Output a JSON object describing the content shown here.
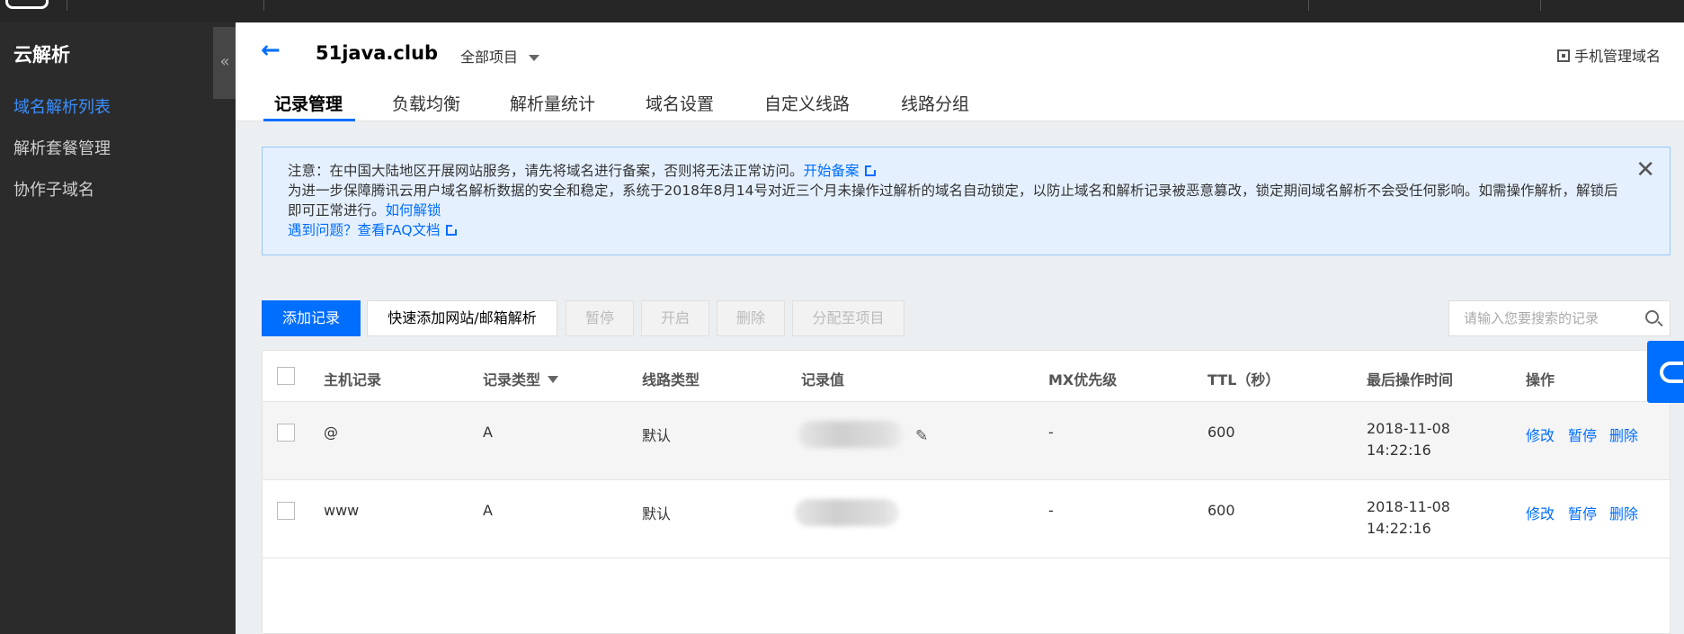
{
  "sidebar": {
    "title": "云解析",
    "collapse_label": "«",
    "items": [
      {
        "label": "域名解析列表",
        "active": true
      },
      {
        "label": "解析套餐管理",
        "active": false
      },
      {
        "label": "协作子域名",
        "active": false
      }
    ]
  },
  "header": {
    "back_icon": "←",
    "domain": "51java.club",
    "project_select": "全部项目",
    "mobile_manage": "手机管理域名"
  },
  "tabs": [
    "记录管理",
    "负载均衡",
    "解析量统计",
    "域名设置",
    "自定义线路",
    "线路分组"
  ],
  "notice": {
    "line1_text": "注意：在中国大陆地区开展网站服务，请先将域名进行备案，否则将无法正常访问。",
    "line1_link": "开始备案",
    "line2_text": "为进一步保障腾讯云用户域名解析数据的安全和稳定，系统于2018年8月14号对近三个月未操作过解析的域名自动锁定，以防止域名和解析记录被恶意篡改，锁定期间域名解析不会受任何影响。如需操作解析，解锁后即可正常进行。",
    "line2_link": "如何解锁",
    "line3_link": "遇到问题？查看FAQ文档",
    "close_icon": "✕"
  },
  "toolbar": {
    "add": "添加记录",
    "quick_add": "快速添加网站/邮箱解析",
    "pause": "暂停",
    "start": "开启",
    "delete": "删除",
    "assign": "分配至项目",
    "search_placeholder": "请输入您要搜索的记录"
  },
  "table": {
    "columns": [
      "主机记录",
      "记录类型",
      "线路类型",
      "记录值",
      "MX优先级",
      "TTL（秒）",
      "最后操作时间",
      "操作"
    ],
    "rows": [
      {
        "host": "@",
        "type": "A",
        "line": "默认",
        "mx": "-",
        "ttl": "600",
        "date": "2018-11-08",
        "time": "14:22:16",
        "actions": [
          "修改",
          "暂停",
          "删除"
        ]
      },
      {
        "host": "www",
        "type": "A",
        "line": "默认",
        "mx": "-",
        "ttl": "600",
        "date": "2018-11-08",
        "time": "14:22:16",
        "actions": [
          "修改",
          "暂停",
          "删除"
        ]
      }
    ]
  },
  "colors": {
    "accent": "#006eff",
    "sidebar_bg": "#2b2b2b",
    "notice_bg": "#e5f0ff"
  }
}
